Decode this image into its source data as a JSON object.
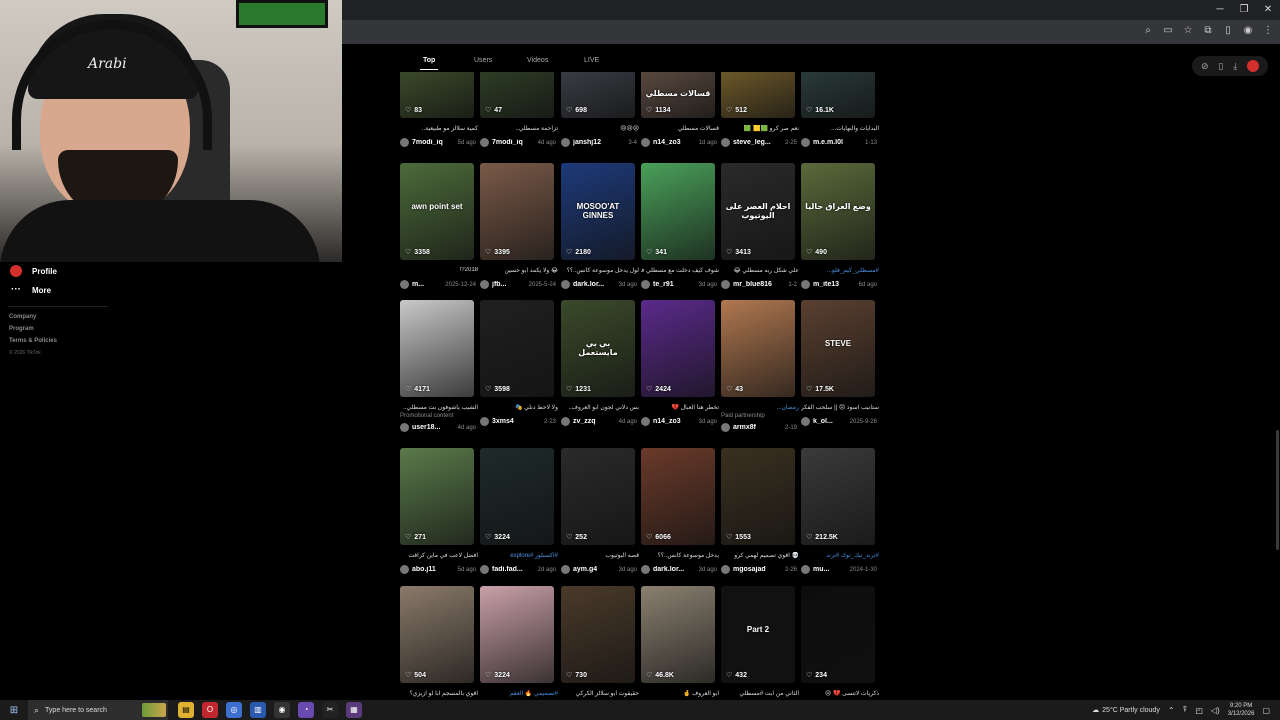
{
  "webcam": {
    "cap_text": "Arabi"
  },
  "tabs": [
    {
      "label": "Top",
      "active": true
    },
    {
      "label": "Users",
      "active": false
    },
    {
      "label": "Videos",
      "active": false
    },
    {
      "label": "LIVE",
      "active": false
    }
  ],
  "sidebar": {
    "profile_label": "Profile",
    "more_label": "More",
    "links": [
      "Company",
      "Program",
      "Terms & Policies"
    ],
    "copyright": "© 2026 TikTok"
  },
  "rows": [
    [
      {
        "likes": "83",
        "desc": "كمية سلالز مو طبيعية..",
        "user": "7modi_iq",
        "date": "5d ago",
        "color": "#3b4a2a"
      },
      {
        "likes": "47",
        "desc": "تزاحمة مسطلي..",
        "user": "7modi_iq",
        "date": "4d ago",
        "color": "#2e3d26"
      },
      {
        "likes": "698",
        "desc": "😢😢😢",
        "user": "janshj12",
        "date": "3-4",
        "color": "#3a3d44"
      },
      {
        "likes": "1134",
        "desc": "قسالات مسطلي",
        "user": "n14_zo3",
        "date": "1d ago",
        "color": "#5a4a40",
        "overlay": "قسالات مسطلي"
      },
      {
        "likes": "512",
        "desc": "نعم صر كرو 🟩🟨 🟩",
        "user": "steve_leg...",
        "date": "2-25",
        "color": "#6e5a2a"
      },
      {
        "likes": "16.1K",
        "desc": "البدايات والنهايات...",
        "user": "m.e.m.l0l",
        "date": "1-13",
        "color": "#2a3a3a"
      }
    ],
    [
      {
        "likes": "3358",
        "desc": "2018?!",
        "user": "m...",
        "date": "2025-12-24",
        "color": "#4d6b3a",
        "overlay": "awn point set"
      },
      {
        "likes": "3395",
        "desc": "😂 ولا يكمد ابو حسين",
        "user": "jfb...",
        "date": "2025-5-24",
        "color": "#7a5a48"
      },
      {
        "likes": "2180",
        "desc": "لول يدخل موسوعة كانس..؟؟",
        "user": "dark.lor...",
        "date": "3d ago",
        "color": "#1e3a7a",
        "overlay": "MOSOO'AT GINNES"
      },
      {
        "likes": "341",
        "desc": "شوف كيف دخلت مع مسطلي في اكرف",
        "user": "te_r91",
        "date": "3d ago",
        "color": "#4aa05a"
      },
      {
        "likes": "3413",
        "desc": "علي شكل ربه مسطلي 😂",
        "user": "mr_blue816",
        "date": "1-2",
        "color": "#2a2a2a",
        "overlay": "احلام العصر على اليوتيوب"
      },
      {
        "likes": "490",
        "desc": "#مسطلي_كيم_فلو...",
        "user": "m_ite13",
        "date": "6d ago",
        "color": "#5a6a3a",
        "overlay": "وضع العراق حاليا",
        "tag": true
      }
    ],
    [
      {
        "likes": "4171",
        "desc": "الشيب ياشوفون بت مسطلي..",
        "sub": "Promotional content",
        "user": "user18...",
        "date": "4d ago",
        "color": "#c9c9c9"
      },
      {
        "likes": "3598",
        "desc": "ولا لاحظ دنلي 🎭",
        "user": "3xms4",
        "date": "2-23",
        "color": "#202020"
      },
      {
        "likes": "1231",
        "desc": "بس دلاني لجون ابو العروف..",
        "user": "zv_zzq",
        "date": "4d ago",
        "color": "#3a4a2a",
        "overlay": "بي بي مايستعمل"
      },
      {
        "likes": "2424",
        "desc": "تخطر هنا العبال 💔",
        "user": "n14_zo3",
        "date": "3d ago",
        "color": "#5a2a8a"
      },
      {
        "likes": "43",
        "desc": "رمضان...",
        "sub": "Paid partnership",
        "user": "armx8f",
        "date": "2-19",
        "color": "#b07850",
        "tag": true
      },
      {
        "likes": "17.5K",
        "desc": "ستانيب اسود 😞 || سلحب الفكرة",
        "user": "k_ol...",
        "date": "2025-9-26",
        "color": "#5a4030",
        "overlay": "STEVE"
      }
    ],
    [
      {
        "likes": "271",
        "desc": "افضل لاعب في ماين كرافت",
        "user": "abo.j11",
        "date": "5d ago",
        "color": "#5a7a4a"
      },
      {
        "likes": "3224",
        "desc": "#اكسبلور #explore",
        "user": "fadi.fad...",
        "date": "2d ago",
        "color": "#1e2a2a",
        "tag": true
      },
      {
        "likes": "252",
        "desc": "قصه اليوتيوب",
        "user": "aym.g4",
        "date": "3d ago",
        "color": "#2a2a2a"
      },
      {
        "likes": "6066",
        "desc": "يدخل موسوعة كانس..؟؟",
        "user": "dark.lor...",
        "date": "3d ago",
        "color": "#6a3a2a"
      },
      {
        "likes": "1553",
        "desc": "💀 اقوي تصميم لهمي كرو",
        "user": "mgosajad",
        "date": "2-26",
        "color": "#3a3020"
      },
      {
        "likes": "212.5K",
        "desc": "#ترند_تيك_توك #ترند",
        "user": "mu...",
        "date": "2024-1-30",
        "color": "#3a3a3a",
        "tag": true
      }
    ],
    [
      {
        "likes": "504",
        "desc": "اقوي بالمسجم انا لو ازيزي؟",
        "user": "",
        "date": "",
        "color": "#8a7a6a"
      },
      {
        "likes": "3224",
        "desc": "#تصميمي 🔥 العقم",
        "user": "",
        "date": "",
        "color": "#c9a0a8",
        "tag": true
      },
      {
        "likes": "730",
        "desc": "حقيقوت ابو سلالز الكركي",
        "user": "",
        "date": "",
        "color": "#4a3a2a"
      },
      {
        "likes": "46.8K",
        "desc": "ابو العروف 🤞",
        "user": "",
        "date": "",
        "color": "#8a8070"
      },
      {
        "likes": "432",
        "desc": "الثاني من ابت #مسطلي",
        "user": "",
        "date": "",
        "color": "#111111",
        "overlay": "Part 2"
      },
      {
        "likes": "234",
        "desc": "ذكريات لاتنسى 💔 😢",
        "user": "",
        "date": "",
        "color": "#0d0d0d"
      }
    ]
  ],
  "taskbar": {
    "search_placeholder": "Type here to search",
    "weather": "25°C  Partly cloudy",
    "time": "9:20 PM",
    "date": "3/12/2026"
  }
}
